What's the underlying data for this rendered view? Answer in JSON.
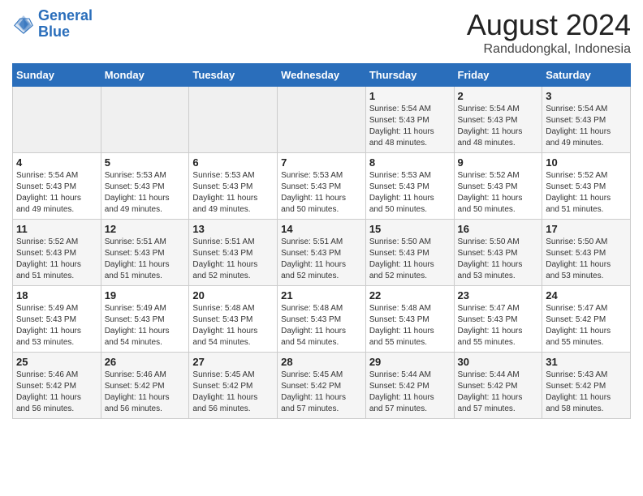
{
  "logo": {
    "line1": "General",
    "line2": "Blue"
  },
  "title": "August 2024",
  "subtitle": "Randudongkal, Indonesia",
  "weekdays": [
    "Sunday",
    "Monday",
    "Tuesday",
    "Wednesday",
    "Thursday",
    "Friday",
    "Saturday"
  ],
  "weeks": [
    [
      {
        "day": "",
        "info": ""
      },
      {
        "day": "",
        "info": ""
      },
      {
        "day": "",
        "info": ""
      },
      {
        "day": "",
        "info": ""
      },
      {
        "day": "1",
        "info": "Sunrise: 5:54 AM\nSunset: 5:43 PM\nDaylight: 11 hours\nand 48 minutes."
      },
      {
        "day": "2",
        "info": "Sunrise: 5:54 AM\nSunset: 5:43 PM\nDaylight: 11 hours\nand 48 minutes."
      },
      {
        "day": "3",
        "info": "Sunrise: 5:54 AM\nSunset: 5:43 PM\nDaylight: 11 hours\nand 49 minutes."
      }
    ],
    [
      {
        "day": "4",
        "info": "Sunrise: 5:54 AM\nSunset: 5:43 PM\nDaylight: 11 hours\nand 49 minutes."
      },
      {
        "day": "5",
        "info": "Sunrise: 5:53 AM\nSunset: 5:43 PM\nDaylight: 11 hours\nand 49 minutes."
      },
      {
        "day": "6",
        "info": "Sunrise: 5:53 AM\nSunset: 5:43 PM\nDaylight: 11 hours\nand 49 minutes."
      },
      {
        "day": "7",
        "info": "Sunrise: 5:53 AM\nSunset: 5:43 PM\nDaylight: 11 hours\nand 50 minutes."
      },
      {
        "day": "8",
        "info": "Sunrise: 5:53 AM\nSunset: 5:43 PM\nDaylight: 11 hours\nand 50 minutes."
      },
      {
        "day": "9",
        "info": "Sunrise: 5:52 AM\nSunset: 5:43 PM\nDaylight: 11 hours\nand 50 minutes."
      },
      {
        "day": "10",
        "info": "Sunrise: 5:52 AM\nSunset: 5:43 PM\nDaylight: 11 hours\nand 51 minutes."
      }
    ],
    [
      {
        "day": "11",
        "info": "Sunrise: 5:52 AM\nSunset: 5:43 PM\nDaylight: 11 hours\nand 51 minutes."
      },
      {
        "day": "12",
        "info": "Sunrise: 5:51 AM\nSunset: 5:43 PM\nDaylight: 11 hours\nand 51 minutes."
      },
      {
        "day": "13",
        "info": "Sunrise: 5:51 AM\nSunset: 5:43 PM\nDaylight: 11 hours\nand 52 minutes."
      },
      {
        "day": "14",
        "info": "Sunrise: 5:51 AM\nSunset: 5:43 PM\nDaylight: 11 hours\nand 52 minutes."
      },
      {
        "day": "15",
        "info": "Sunrise: 5:50 AM\nSunset: 5:43 PM\nDaylight: 11 hours\nand 52 minutes."
      },
      {
        "day": "16",
        "info": "Sunrise: 5:50 AM\nSunset: 5:43 PM\nDaylight: 11 hours\nand 53 minutes."
      },
      {
        "day": "17",
        "info": "Sunrise: 5:50 AM\nSunset: 5:43 PM\nDaylight: 11 hours\nand 53 minutes."
      }
    ],
    [
      {
        "day": "18",
        "info": "Sunrise: 5:49 AM\nSunset: 5:43 PM\nDaylight: 11 hours\nand 53 minutes."
      },
      {
        "day": "19",
        "info": "Sunrise: 5:49 AM\nSunset: 5:43 PM\nDaylight: 11 hours\nand 54 minutes."
      },
      {
        "day": "20",
        "info": "Sunrise: 5:48 AM\nSunset: 5:43 PM\nDaylight: 11 hours\nand 54 minutes."
      },
      {
        "day": "21",
        "info": "Sunrise: 5:48 AM\nSunset: 5:43 PM\nDaylight: 11 hours\nand 54 minutes."
      },
      {
        "day": "22",
        "info": "Sunrise: 5:48 AM\nSunset: 5:43 PM\nDaylight: 11 hours\nand 55 minutes."
      },
      {
        "day": "23",
        "info": "Sunrise: 5:47 AM\nSunset: 5:43 PM\nDaylight: 11 hours\nand 55 minutes."
      },
      {
        "day": "24",
        "info": "Sunrise: 5:47 AM\nSunset: 5:42 PM\nDaylight: 11 hours\nand 55 minutes."
      }
    ],
    [
      {
        "day": "25",
        "info": "Sunrise: 5:46 AM\nSunset: 5:42 PM\nDaylight: 11 hours\nand 56 minutes."
      },
      {
        "day": "26",
        "info": "Sunrise: 5:46 AM\nSunset: 5:42 PM\nDaylight: 11 hours\nand 56 minutes."
      },
      {
        "day": "27",
        "info": "Sunrise: 5:45 AM\nSunset: 5:42 PM\nDaylight: 11 hours\nand 56 minutes."
      },
      {
        "day": "28",
        "info": "Sunrise: 5:45 AM\nSunset: 5:42 PM\nDaylight: 11 hours\nand 57 minutes."
      },
      {
        "day": "29",
        "info": "Sunrise: 5:44 AM\nSunset: 5:42 PM\nDaylight: 11 hours\nand 57 minutes."
      },
      {
        "day": "30",
        "info": "Sunrise: 5:44 AM\nSunset: 5:42 PM\nDaylight: 11 hours\nand 57 minutes."
      },
      {
        "day": "31",
        "info": "Sunrise: 5:43 AM\nSunset: 5:42 PM\nDaylight: 11 hours\nand 58 minutes."
      }
    ]
  ]
}
